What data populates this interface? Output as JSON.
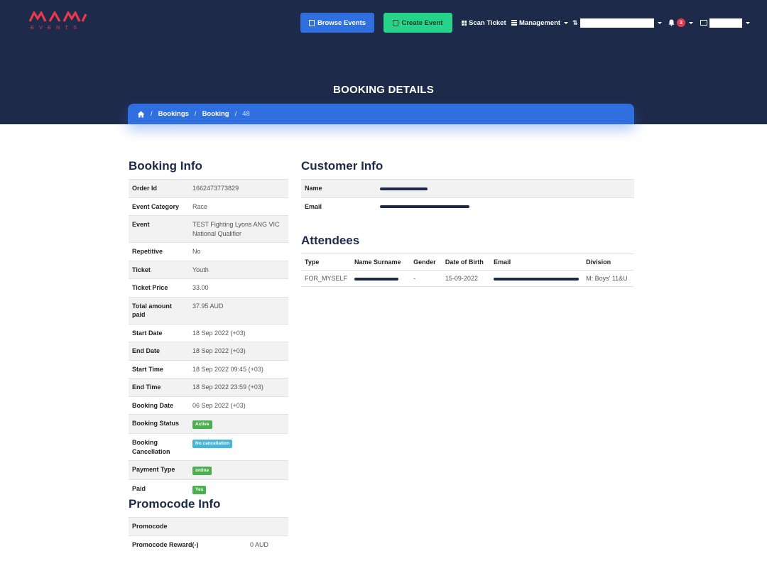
{
  "header": {
    "logo_text": "EVENTS",
    "browse_label": "Browse Events",
    "create_label": "Create Event",
    "scan_label": "Scan Ticket",
    "management_label": "Management",
    "notification_count": "3"
  },
  "page": {
    "title": "BOOKING DETAILS"
  },
  "breadcrumb": {
    "items": [
      "Bookings",
      "Booking"
    ],
    "current": "48"
  },
  "booking_info": {
    "heading": "Booking Info",
    "order_id_label": "Order Id",
    "order_id": "1662473773829",
    "category_label": "Event Category",
    "category": "Race",
    "event_label": "Event",
    "event": "TEST Fighting Lyons ANG VIC National Qualifier",
    "repetitive_label": "Repetitive",
    "repetitive": "No",
    "ticket_label": "Ticket",
    "ticket": "Youth",
    "ticket_price_label": "Ticket Price",
    "ticket_price": "33.00",
    "total_label": "Total amount paid",
    "total": "37.95 AUD",
    "start_date_label": "Start Date",
    "start_date": "18 Sep 2022 (+03)",
    "end_date_label": "End Date",
    "end_date": "18 Sep 2022 (+03)",
    "start_time_label": "Start Time",
    "start_time": "18 Sep 2022 09:45 (+03)",
    "end_time_label": "End Time",
    "end_time": "18 Sep 2022 23:59 (+03)",
    "booking_date_label": "Booking Date",
    "booking_date": "06 Sep 2022 (+03)",
    "status_label": "Booking Status",
    "status": "Active",
    "cancellation_label": "Booking Cancellation",
    "cancellation": "No cancellation",
    "payment_type_label": "Payment Type",
    "payment_type": "online",
    "paid_label": "Paid",
    "paid": "Yes"
  },
  "promocode_info": {
    "heading": "Promocode Info",
    "promocode_label": "Promocode",
    "promocode": "",
    "reward_label": "Promocode Reward(-)",
    "reward": "0 AUD"
  },
  "customer_info": {
    "heading": "Customer Info",
    "name_label": "Name",
    "email_label": "Email"
  },
  "attendees": {
    "heading": "Attendees",
    "columns": [
      "Type",
      "Name Surname",
      "Gender",
      "Date of Birth",
      "Email",
      "Division"
    ],
    "rows": [
      {
        "type": "FOR_MYSELF",
        "gender": "-",
        "dob": "15-09-2022",
        "division": "M: Boys' 11&U"
      }
    ]
  },
  "colors": {
    "header_bg": "#1e2a4a",
    "primary": "#2f6fe0",
    "create": "#25d48a",
    "logo": "#e8394d",
    "success": "#4caf50",
    "info": "#47b4d9"
  }
}
